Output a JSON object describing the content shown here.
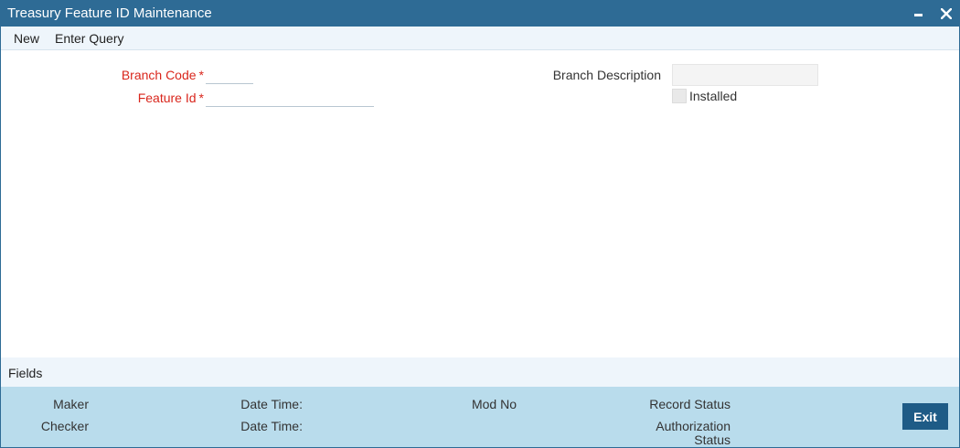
{
  "window": {
    "title": "Treasury Feature ID Maintenance"
  },
  "menu": {
    "new_label": "New",
    "enter_query_label": "Enter Query"
  },
  "form": {
    "branch_code": {
      "label": "Branch Code",
      "required_mark": "*",
      "value": ""
    },
    "feature_id": {
      "label": "Feature Id",
      "required_mark": "*",
      "value": ""
    },
    "branch_description": {
      "label": "Branch Description",
      "value": ""
    },
    "installed": {
      "label": "Installed",
      "checked": false
    }
  },
  "fields_bar": {
    "label": "Fields"
  },
  "audit": {
    "maker_label": "Maker",
    "checker_label": "Checker",
    "maker_datetime_label": "Date Time:",
    "checker_datetime_label": "Date Time:",
    "mod_no_label": "Mod No",
    "record_status_label": "Record Status",
    "authorization_status_label_line1": "Authorization",
    "authorization_status_label_line2": "Status"
  },
  "buttons": {
    "exit_label": "Exit"
  },
  "colors": {
    "titlebar": "#2e6b95",
    "menubar": "#eef5fb",
    "audit_bg": "#b9dcec",
    "exit_button": "#1e5b86",
    "required_label": "#d9261c"
  },
  "icons": {
    "minimize": "minimize-icon",
    "close": "close-icon"
  }
}
